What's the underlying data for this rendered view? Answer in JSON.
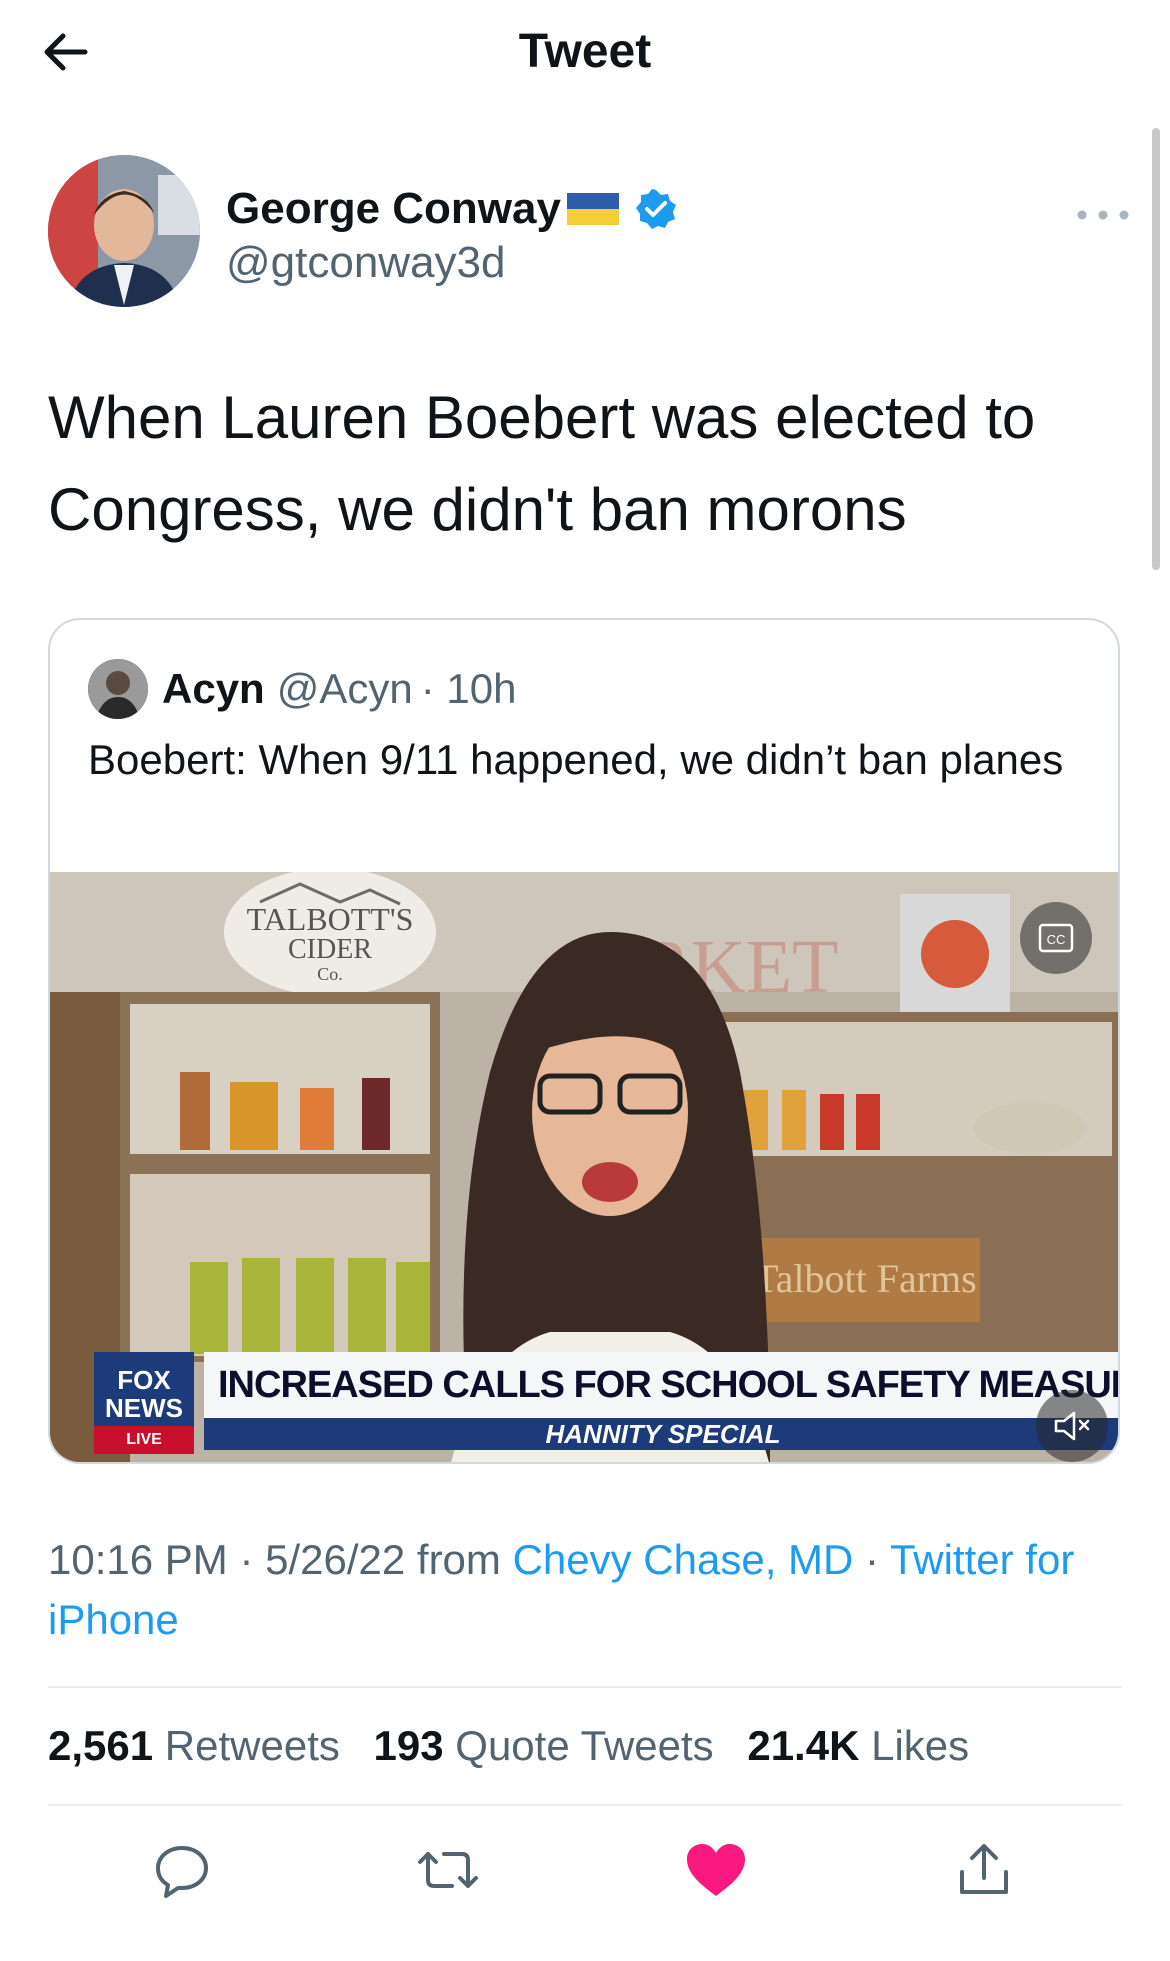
{
  "header": {
    "title": "Tweet",
    "back_icon": "back-arrow-icon"
  },
  "tweet": {
    "author_name": "George Conway",
    "author_handle": "@gtconway3d",
    "text": "When Lauren Boebert was elected to Congress, we didn't ban morons",
    "timestamp_time": "10:16 PM · 5/26/22",
    "from_label": " from ",
    "location": "Chevy Chase, MD",
    "separator": " · ",
    "client": "Twitter for iPhone"
  },
  "quote": {
    "name": "Acyn",
    "handle": "@Acyn",
    "age": "· 10h",
    "text": "Boebert: When 9/11 happened, we didn’t ban planes",
    "video": {
      "sign_text": "TALBOTT'S CIDER Co.",
      "chyron_logo": "FOX NEWS",
      "chyron_logo_sub": "LIVE",
      "chyron_headline": "INCREASED CALLS FOR SCHOOL SAFETY MEASURES",
      "chyron_sub": "HANNITY SPECIAL"
    }
  },
  "stats": {
    "retweets_count": "2,561",
    "retweets_label": "Retweets",
    "quotes_count": "193",
    "quotes_label": "Quote Tweets",
    "likes_count": "21.4K",
    "likes_label": "Likes"
  },
  "colors": {
    "link": "#1d9bf0",
    "like": "#f91880",
    "muted": "#536471",
    "verified": "#1d9bf0"
  }
}
